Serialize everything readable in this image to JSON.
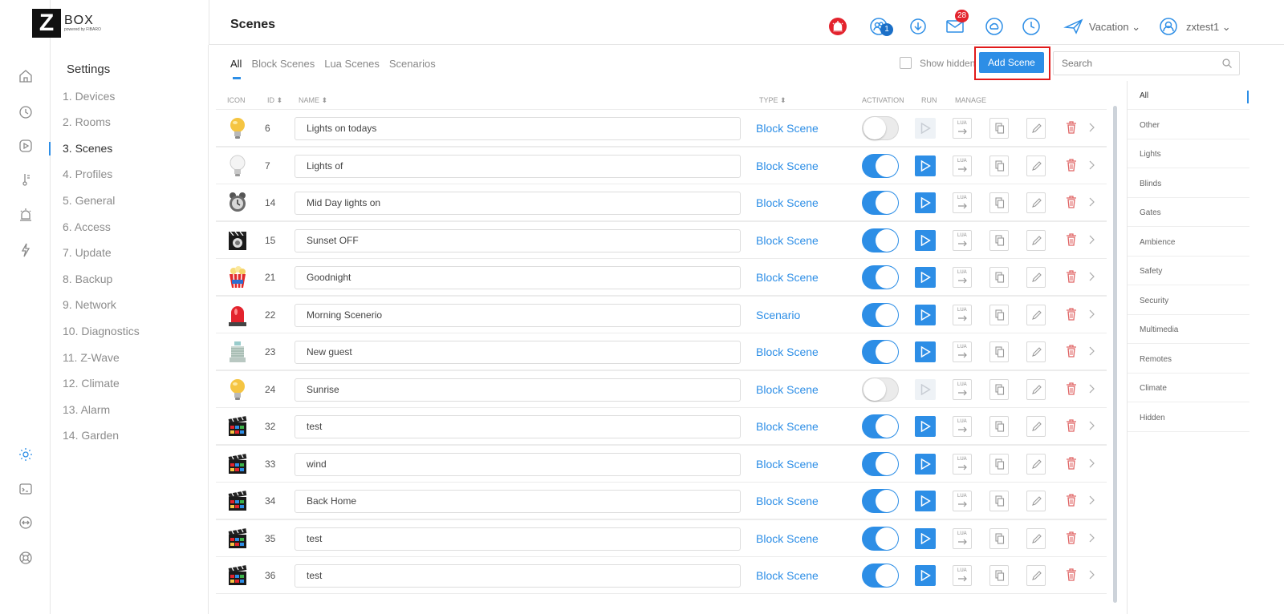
{
  "logo": {
    "mark": "Z",
    "text": "BOX",
    "subtext": "powered by FIBARO"
  },
  "header": {
    "title": "Scenes",
    "notifications_badge": "1",
    "messages_badge": "28",
    "mode_label": "Vacation",
    "user_label": "zxtest1"
  },
  "settings": {
    "title": "Settings",
    "items": [
      "1. Devices",
      "2. Rooms",
      "3. Scenes",
      "4. Profiles",
      "5. General",
      "6. Access",
      "7. Update",
      "8. Backup",
      "9. Network",
      "10. Diagnostics",
      "11. Z-Wave",
      "12. Climate",
      "13. Alarm",
      "14. Garden"
    ]
  },
  "tabs": [
    "All",
    "Block Scenes",
    "Lua Scenes",
    "Scenarios"
  ],
  "toolbar": {
    "show_hidden_label": "Show hidden",
    "add_scene_label": "Add Scene",
    "search_placeholder": "Search"
  },
  "table": {
    "headers": {
      "icon": "ICON",
      "id": "ID ⬍",
      "name": "NAME ⬍",
      "type": "TYPE ⬍",
      "activation": "ACTIVATION",
      "run": "RUN",
      "manage": "MANAGE"
    },
    "lua_label": "LUA",
    "rows": [
      {
        "icon": "lightbulb-on-icon",
        "id": "6",
        "name": "Lights on todays",
        "type": "Block Scene",
        "active": false
      },
      {
        "icon": "lightbulb-off-icon",
        "id": "7",
        "name": "Lights of",
        "type": "Block Scene",
        "active": true
      },
      {
        "icon": "alarm-clock-icon",
        "id": "14",
        "name": "Mid Day lights on",
        "type": "Block Scene",
        "active": true
      },
      {
        "icon": "camera-icon",
        "id": "15",
        "name": "Sunset OFF",
        "type": "Block Scene",
        "active": true
      },
      {
        "icon": "popcorn-icon",
        "id": "21",
        "name": "Goodnight",
        "type": "Block Scene",
        "active": true
      },
      {
        "icon": "siren-icon",
        "id": "22",
        "name": "Morning Scenerio",
        "type": "Scenario",
        "active": true
      },
      {
        "icon": "welcome-mat-icon",
        "id": "23",
        "name": "New guest",
        "type": "Block Scene",
        "active": true
      },
      {
        "icon": "lightbulb-on-icon",
        "id": "24",
        "name": "Sunrise",
        "type": "Block Scene",
        "active": false
      },
      {
        "icon": "clapperboard-icon",
        "id": "32",
        "name": "test",
        "type": "Block Scene",
        "active": true
      },
      {
        "icon": "clapperboard-icon",
        "id": "33",
        "name": "wind",
        "type": "Block Scene",
        "active": true
      },
      {
        "icon": "clapperboard-icon",
        "id": "34",
        "name": "Back Home",
        "type": "Block Scene",
        "active": true
      },
      {
        "icon": "clapperboard-icon",
        "id": "35",
        "name": "test",
        "type": "Block Scene",
        "active": true
      },
      {
        "icon": "clapperboard-icon",
        "id": "36",
        "name": "test",
        "type": "Block Scene",
        "active": true
      }
    ]
  },
  "categories": [
    "All",
    "Other",
    "Lights",
    "Blinds",
    "Gates",
    "Ambience",
    "Safety",
    "Security",
    "Multimedia",
    "Remotes",
    "Climate",
    "Hidden"
  ],
  "colors": {
    "accent": "#2d8ee6",
    "alert": "#e3232d",
    "delete": "#e06666",
    "highlight_box": "#e11a1a"
  }
}
